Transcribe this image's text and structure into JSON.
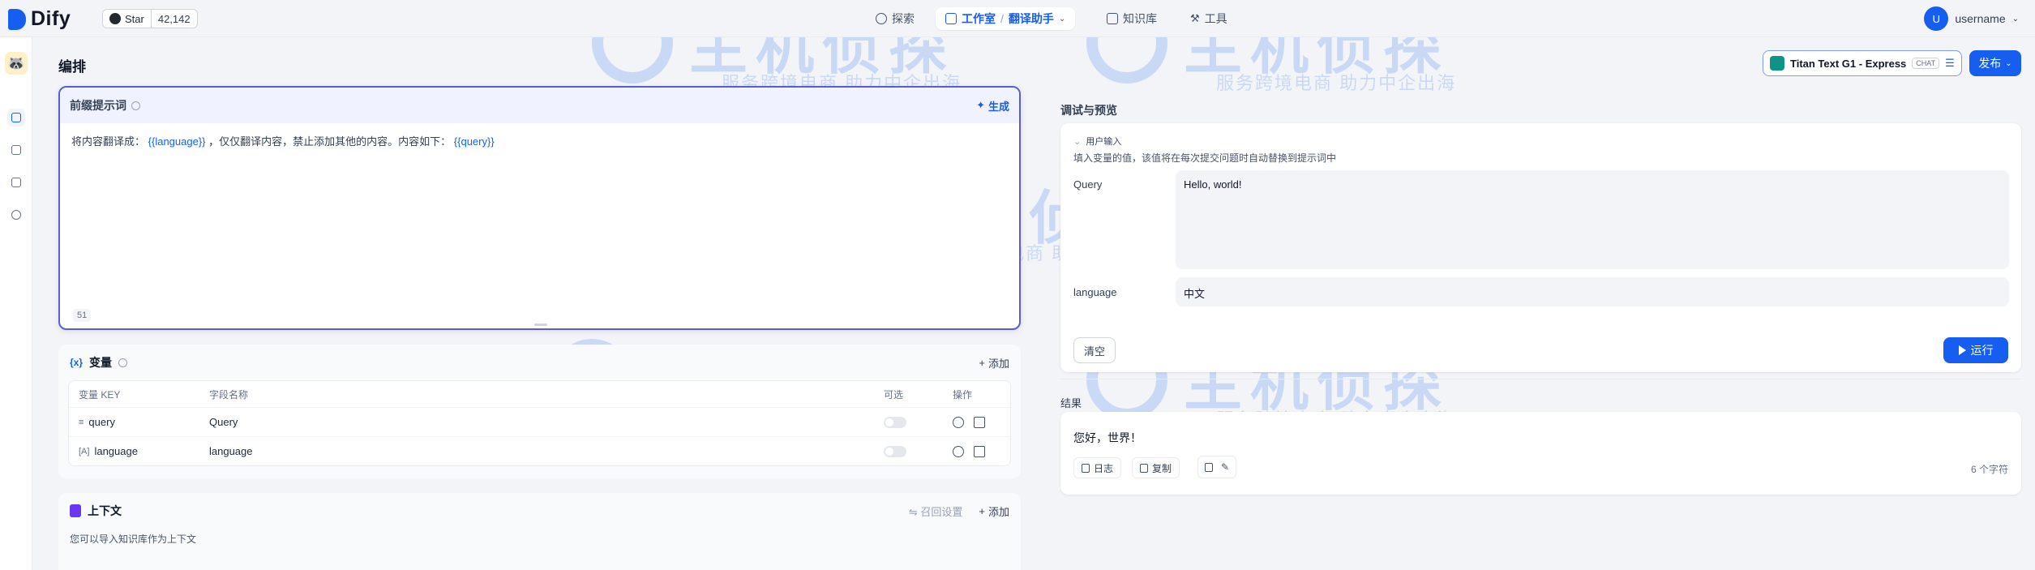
{
  "brand": {
    "name": "Dify",
    "primary": "#155eef",
    "prompt_border": "#5b5bd6"
  },
  "github": {
    "label": "Star",
    "count": "42,142"
  },
  "nav": {
    "explore": "探索",
    "studio": "工作室",
    "studio_sub": "翻译助手",
    "knowledge": "知识库",
    "tools": "工具"
  },
  "user": {
    "initial": "U",
    "name": "username"
  },
  "main": {
    "title": "编排",
    "model_name": "Titan Text G1 - Express",
    "model_tag": "CHAT",
    "publish": "发布"
  },
  "prompt": {
    "title": "前缀提示词",
    "generate": "生成",
    "text_before": "将内容翻译成：",
    "var1": "{{language}}",
    "text_middle": "，仅仅翻译内容，禁止添加其他的内容。内容如下：",
    "var2": "{{query}}",
    "char_count": "51"
  },
  "variables": {
    "title": "变量",
    "add": "添加",
    "headers": {
      "key": "变量 KEY",
      "name": "字段名称",
      "optional": "可选",
      "actions": "操作"
    },
    "rows": [
      {
        "icon": "≡",
        "key": "query",
        "name": "Query"
      },
      {
        "icon": "[A]",
        "key": "language",
        "name": "language"
      }
    ]
  },
  "context": {
    "title": "上下文",
    "recall": "召回设置",
    "add": "添加",
    "desc": "您可以导入知识库作为上下文"
  },
  "debug": {
    "title": "调试与预览",
    "user_input": "用户输入",
    "hint": "填入变量的值，该值将在每次提交问题时自动替换到提示词中",
    "fields": [
      {
        "label": "Query",
        "value": "Hello, world!"
      },
      {
        "label": "language",
        "value": "中文"
      }
    ],
    "clear": "清空",
    "run": "运行"
  },
  "result": {
    "title": "结果",
    "text": "您好，世界！",
    "log": "日志",
    "copy": "复制",
    "char_count": "6 个字符"
  },
  "watermark": {
    "main": "主机侦探",
    "sub": "服务跨境电商 助力中企出海"
  }
}
